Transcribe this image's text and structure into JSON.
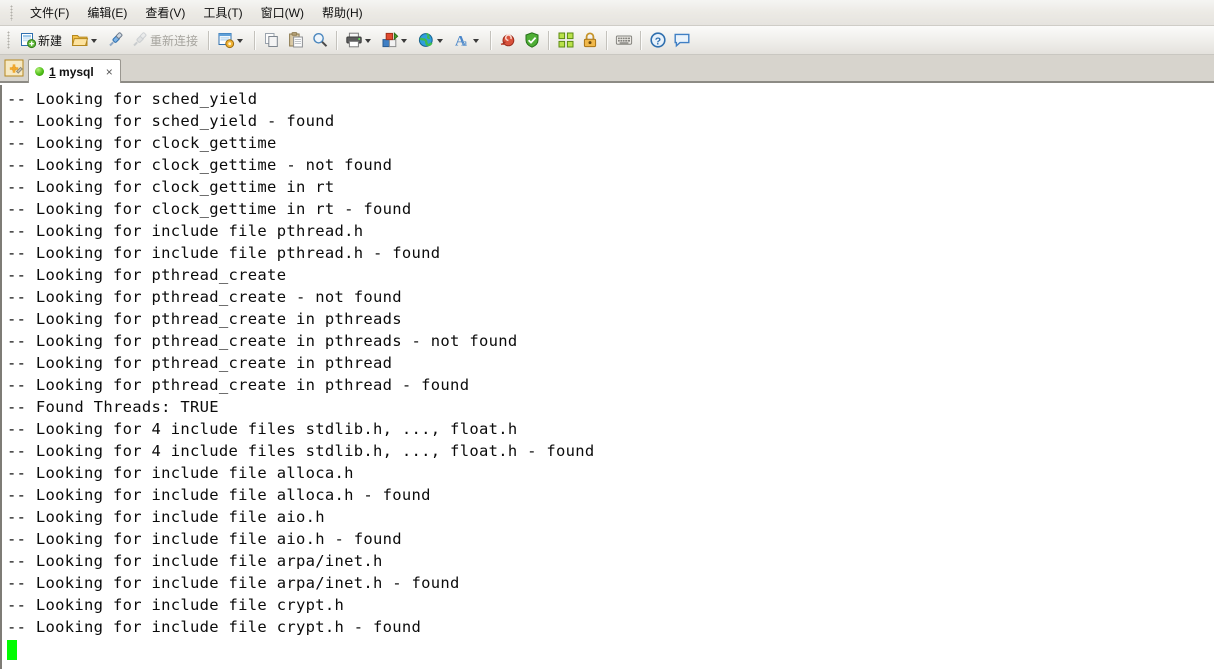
{
  "menubar": {
    "items": [
      {
        "label": "文件(F)",
        "name": "menu-file"
      },
      {
        "label": "编辑(E)",
        "name": "menu-edit"
      },
      {
        "label": "查看(V)",
        "name": "menu-view"
      },
      {
        "label": "工具(T)",
        "name": "menu-tools"
      },
      {
        "label": "窗口(W)",
        "name": "menu-window"
      },
      {
        "label": "帮助(H)",
        "name": "menu-help"
      }
    ]
  },
  "toolbar": {
    "new_label": "新建",
    "new_icon": "new-document-icon",
    "open_icon": "open-folder-icon",
    "connect_icon": "connect-plug-icon",
    "reconnect_label": "重新连接",
    "reconnect_icon": "reconnect-icon",
    "query_icon": "query-window-icon",
    "copy_icon": "copy-icon",
    "paste_icon": "paste-icon",
    "find_icon": "search-icon",
    "print_icon": "printer-icon",
    "export_icon": "export-color-icon",
    "web_icon": "globe-icon",
    "font_icon": "font-icon",
    "snail_icon": "snail-icon",
    "shield_icon": "shield-icon",
    "grid_icon": "grid-icon",
    "lock_icon": "lock-icon",
    "keyboard_icon": "keyboard-icon",
    "help_icon": "help-icon",
    "comment_icon": "comment-icon"
  },
  "tabstrip": {
    "app_icon": "app-editor-icon",
    "tab": {
      "index": "1",
      "title": "mysql",
      "status_dot": "connected-status-dot",
      "close_label": "×"
    }
  },
  "console": {
    "cursor_color": "#00fc00",
    "lines": [
      "-- Looking for sched_yield",
      "-- Looking for sched_yield - found",
      "-- Looking for clock_gettime",
      "-- Looking for clock_gettime - not found",
      "-- Looking for clock_gettime in rt",
      "-- Looking for clock_gettime in rt - found",
      "-- Looking for include file pthread.h",
      "-- Looking for include file pthread.h - found",
      "-- Looking for pthread_create",
      "-- Looking for pthread_create - not found",
      "-- Looking for pthread_create in pthreads",
      "-- Looking for pthread_create in pthreads - not found",
      "-- Looking for pthread_create in pthread",
      "-- Looking for pthread_create in pthread - found",
      "-- Found Threads: TRUE",
      "-- Looking for 4 include files stdlib.h, ..., float.h",
      "-- Looking for 4 include files stdlib.h, ..., float.h - found",
      "-- Looking for include file alloca.h",
      "-- Looking for include file alloca.h - found",
      "-- Looking for include file aio.h",
      "-- Looking for include file aio.h - found",
      "-- Looking for include file arpa/inet.h",
      "-- Looking for include file arpa/inet.h - found",
      "-- Looking for include file crypt.h",
      "-- Looking for include file crypt.h - found"
    ]
  }
}
